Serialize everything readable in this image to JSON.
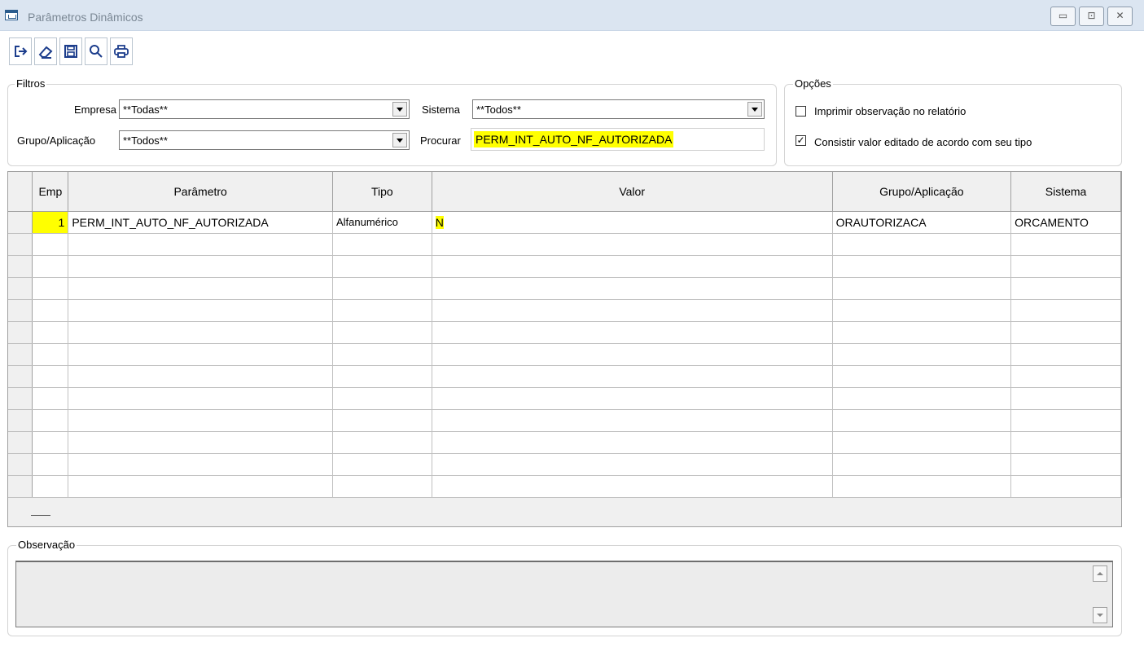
{
  "window": {
    "title": "Parâmetros Dinâmicos",
    "min_glyph": "▭",
    "max_glyph": "⊡",
    "close_glyph": "✕"
  },
  "toolbar": {
    "buttons": [
      {
        "icon": "exit-icon",
        "highlighted": false
      },
      {
        "icon": "eraser-icon",
        "highlighted": false
      },
      {
        "icon": "save-icon",
        "highlighted": true
      },
      {
        "icon": "search-icon",
        "highlighted": false
      },
      {
        "icon": "print-icon",
        "highlighted": false
      }
    ]
  },
  "filtros": {
    "legend": "Filtros",
    "empresa_label": "Empresa",
    "empresa_value": "**Todas**",
    "grupo_label": "Grupo/Aplicação",
    "grupo_value": "**Todos**",
    "sistema_label": "Sistema",
    "sistema_value": "**Todos**",
    "procurar_label": "Procurar",
    "procurar_value": "PERM_INT_AUTO_NF_AUTORIZADA"
  },
  "opcoes": {
    "legend": "Opções",
    "imprimir_label": "Imprimir observação no relatório",
    "imprimir_checked": false,
    "consistir_label": "Consistir valor editado de acordo com seu tipo",
    "consistir_checked": true,
    "check_glyph": "✓"
  },
  "grid": {
    "columns": [
      "Emp",
      "Parâmetro",
      "Tipo",
      "Valor",
      "Grupo/Aplicação",
      "Sistema"
    ],
    "rows": [
      {
        "emp": "1",
        "parametro": "PERM_INT_AUTO_NF_AUTORIZADA",
        "tipo": "Alfanumérico",
        "valor": "N",
        "grupo": "ORAUTORIZACA",
        "sistema": "ORCAMENTO"
      }
    ],
    "empty_rows": 12
  },
  "observacao": {
    "legend": "Observação",
    "value": ""
  },
  "colors": {
    "highlight": "#ffff00",
    "titlebar": "#dbe5f1",
    "icon_blue": "#1c3d8c"
  }
}
